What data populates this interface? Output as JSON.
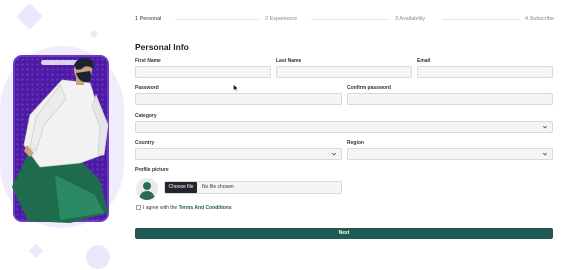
{
  "steps": [
    {
      "label": "1  Personal",
      "active": true
    },
    {
      "label": "2  Experience",
      "active": false
    },
    {
      "label": "3  Availability",
      "active": false
    },
    {
      "label": "4  Subscribe",
      "active": false
    }
  ],
  "form": {
    "title": "Personal Info",
    "first_name": {
      "label": "First Name",
      "value": ""
    },
    "last_name": {
      "label": "Last Name",
      "value": ""
    },
    "email": {
      "label": "Email",
      "value": ""
    },
    "password": {
      "label": "Password",
      "value": ""
    },
    "confirm_password": {
      "label": "Confirm password",
      "value": ""
    },
    "category": {
      "label": "Category",
      "value": ""
    },
    "country": {
      "label": "Country",
      "value": ""
    },
    "region": {
      "label": "Region",
      "value": ""
    },
    "profile_picture": {
      "label": "Profile picture",
      "button": "Choose file",
      "status": "No file chosen"
    },
    "terms": {
      "prefix": "I agree with the ",
      "link": "Terms And Conditions",
      "checked": false
    },
    "next_label": "Next"
  },
  "colors": {
    "accent": "#1e5a52",
    "phone": "#4d1aa3",
    "blob": "#f0ecfb"
  }
}
